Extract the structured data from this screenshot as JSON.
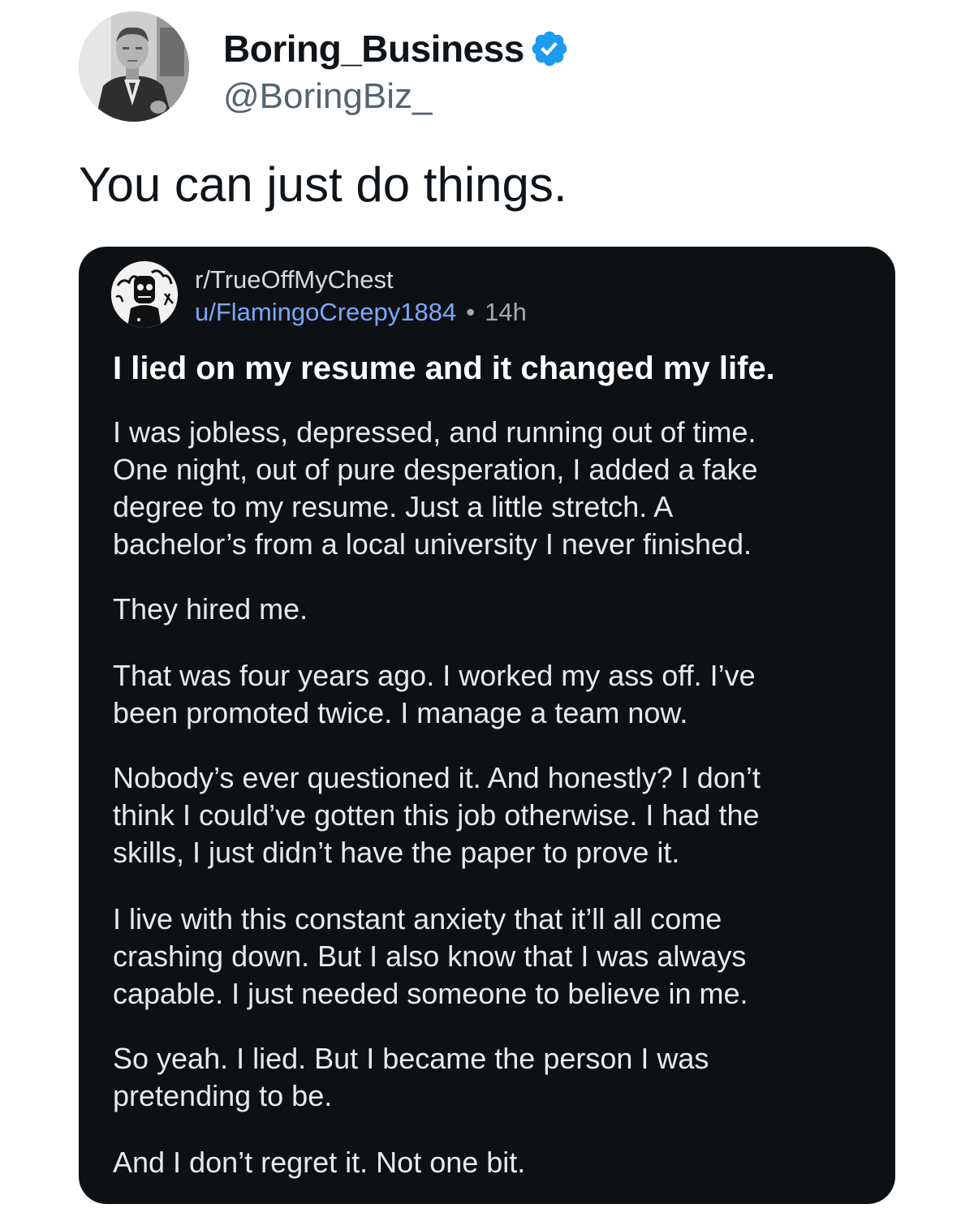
{
  "tweet": {
    "author_name": "Boring_Business",
    "author_handle": "@BoringBiz_",
    "verified": true,
    "verified_color": "#1d9bf0",
    "text": "You can just do things."
  },
  "reddit_post": {
    "subreddit": "r/TrueOffMyChest",
    "username": "u/FlamingoCreepy1884",
    "separator": "•",
    "age": "14h",
    "title": "I lied on my resume and it changed my life.",
    "paragraphs": [
      "I was jobless, depressed, and running out of time.\nOne night, out of pure desperation, I added a fake\ndegree to my resume. Just a little stretch. A\nbachelor’s from a local university I never finished.",
      "They hired me.",
      "That was four years ago. I worked my ass off. I’ve\nbeen promoted twice. I manage a team now.",
      "Nobody’s ever questioned it. And honestly? I don’t\nthink I could’ve gotten this job otherwise. I had the\nskills, I just didn’t have the paper to prove it.",
      "I live with this constant anxiety that it’ll all come\ncrashing down. But I also know that I was always\ncapable. I just needed someone to believe in me.",
      "So yeah. I lied. But I became the person I was\npretending to be.",
      "And I don’t regret it. Not one bit."
    ],
    "card_bg": "#0e1113",
    "username_color": "#7ba8ff"
  }
}
